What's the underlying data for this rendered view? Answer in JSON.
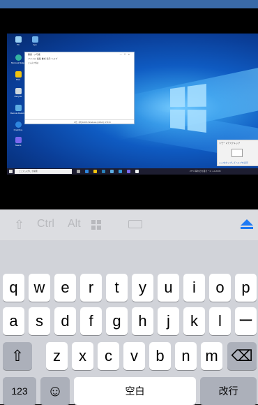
{
  "desktop": {
    "icons": [
      "PC",
      "Microsoft Edge",
      "Files",
      "Recycle",
      "Remote Desktop",
      "OneDrive",
      "Teams",
      "App"
    ],
    "notepad": {
      "title": "無題 - メモ帳",
      "menu": "ファイル  編集  書式  表示  ヘルプ",
      "body": "こんにちは",
      "status": "1行, 1列     100%   Windows (CRLF)   UTF-8"
    },
    "toast": {
      "title": "リモートデスクトップ",
      "link": "ここをタップしてヘルプを表示"
    },
    "taskbar": {
      "search_placeholder": "ここに入力して検索",
      "tray": "27°C 晴れのち曇り  ^  ⊡  ♪  A  20:05"
    }
  },
  "toolbar": {
    "shift_glyph": "⇧",
    "ctrl_label": "Ctrl",
    "alt_label": "Alt"
  },
  "keyboard": {
    "row1": [
      "q",
      "w",
      "e",
      "r",
      "t",
      "y",
      "u",
      "i",
      "o",
      "p"
    ],
    "row2": [
      "a",
      "s",
      "d",
      "f",
      "g",
      "h",
      "j",
      "k",
      "l",
      "ー"
    ],
    "row3": [
      "z",
      "x",
      "c",
      "v",
      "b",
      "n",
      "m"
    ],
    "shift_glyph": "⇧",
    "delete_glyph": "⌫",
    "numbers_label": "123",
    "emoji_glyph": "☺",
    "space_label": "空白",
    "return_label": "改行"
  }
}
